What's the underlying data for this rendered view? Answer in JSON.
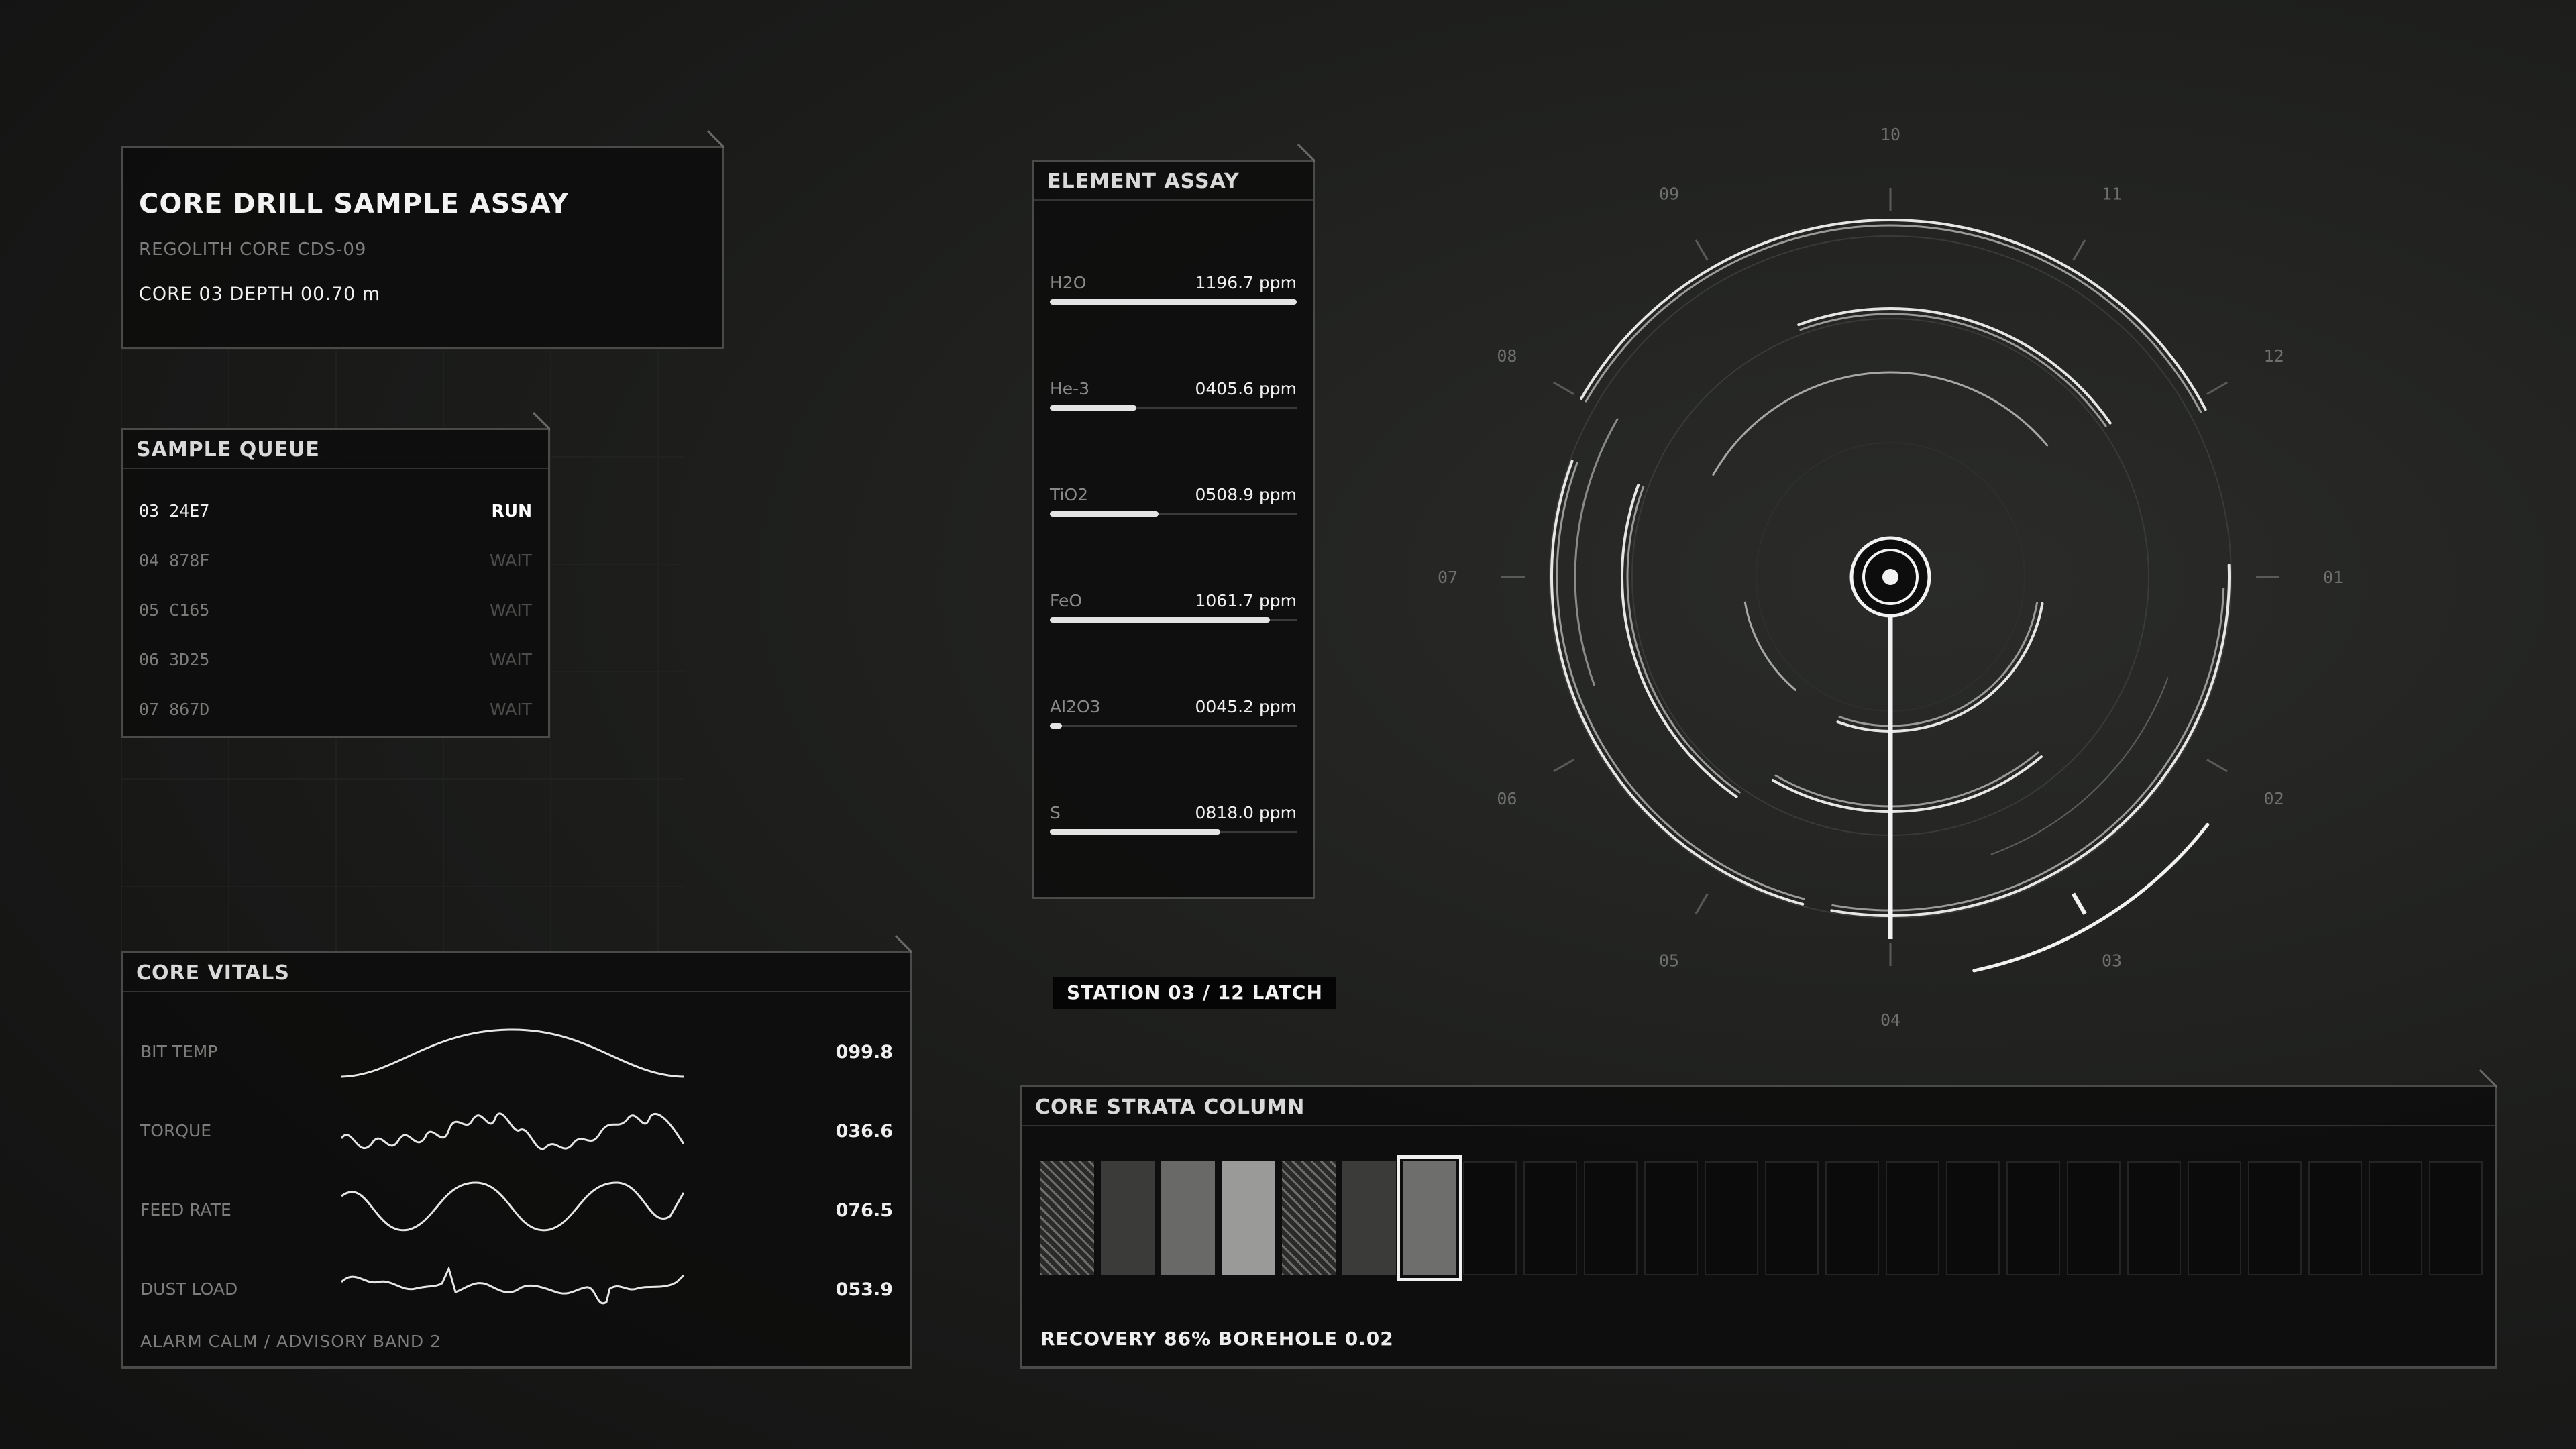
{
  "header": {
    "title": "CORE DRILL SAMPLE ASSAY",
    "subtitle": "REGOLITH CORE  CDS-09",
    "status_line": "CORE 03  DEPTH 00.70 m"
  },
  "queue": {
    "title": "SAMPLE QUEUE",
    "items": [
      {
        "id": "03 24E7",
        "status": "RUN"
      },
      {
        "id": "04 878F",
        "status": "WAIT"
      },
      {
        "id": "05 C165",
        "status": "WAIT"
      },
      {
        "id": "06 3D25",
        "status": "WAIT"
      },
      {
        "id": "07 867D",
        "status": "WAIT"
      }
    ]
  },
  "assay": {
    "title": "ELEMENT ASSAY",
    "items": [
      {
        "name": "H2O",
        "value": "1196.7 ppm",
        "level": 1.0
      },
      {
        "name": "He-3",
        "value": "0405.6 ppm",
        "level": 0.35
      },
      {
        "name": "TiO2",
        "value": "0508.9 ppm",
        "level": 0.44
      },
      {
        "name": "FeO",
        "value": "1061.7 ppm",
        "level": 0.89
      },
      {
        "name": "Al2O3",
        "value": "0045.2 ppm",
        "level": 0.05
      },
      {
        "name": "S",
        "value": "0818.0 ppm",
        "level": 0.69
      }
    ]
  },
  "station": {
    "label": "STATION 03 / 12   LATCH"
  },
  "vitals": {
    "title": "CORE VITALS",
    "rows": [
      {
        "label": "BIT TEMP",
        "value": "099.8"
      },
      {
        "label": "TORQUE",
        "value": "036.6"
      },
      {
        "label": "FEED RATE",
        "value": "076.5"
      },
      {
        "label": "DUST LOAD",
        "value": "053.9"
      }
    ],
    "footer": "ALARM  CALM / ADVISORY BAND 2"
  },
  "strata": {
    "title": "CORE STRATA COLUMN",
    "footer": "RECOVERY 86%   BOREHOLE 0.02",
    "cells": [
      "hatch",
      "#3b3c3a",
      "#696a68",
      "#9a9b99",
      "hatch",
      "#3b3c3a",
      "#6e6f6d",
      "empty",
      "empty",
      "empty",
      "empty",
      "empty",
      "empty",
      "empty",
      "empty",
      "empty",
      "empty",
      "empty",
      "empty",
      "empty",
      "empty",
      "empty",
      "empty",
      "empty"
    ],
    "selected_index": 6
  },
  "dial": {
    "labels": [
      "10",
      "11",
      "12",
      "01",
      "02",
      "03",
      "04",
      "05",
      "06",
      "07",
      "08",
      "09"
    ],
    "active": "03"
  }
}
